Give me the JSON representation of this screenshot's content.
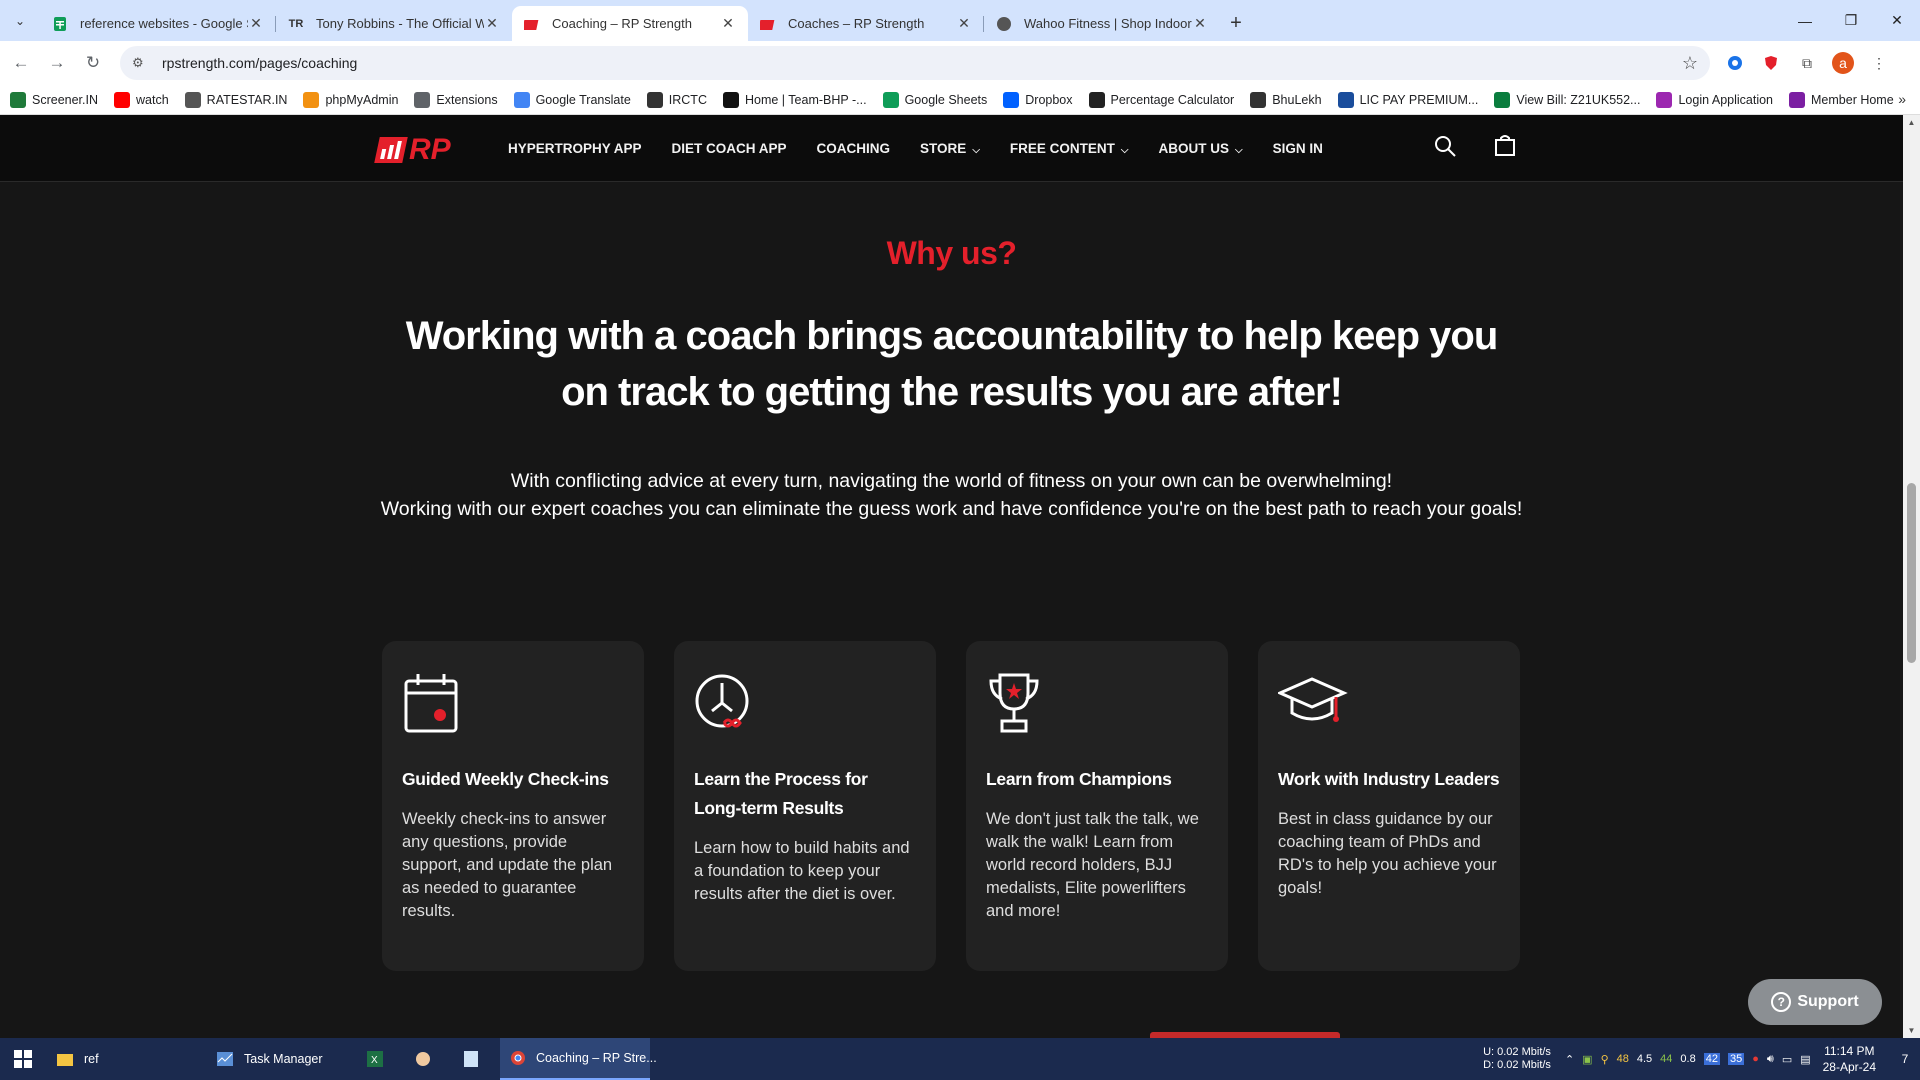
{
  "browser": {
    "tabs": [
      {
        "title": "reference websites - Google Sh",
        "icon": "sheets-icon",
        "active": false
      },
      {
        "title": "Tony Robbins - The Official Wel",
        "icon": "tr-icon",
        "icon_text": "TR",
        "active": false
      },
      {
        "title": "Coaching – RP Strength",
        "icon": "rp-icon",
        "active": true
      },
      {
        "title": "Coaches – RP Strength",
        "icon": "rp-icon",
        "active": false
      },
      {
        "title": "Wahoo Fitness | Shop Indoor Bi",
        "icon": "wahoo-icon",
        "active": false
      }
    ],
    "url": "rpstrength.com/pages/coaching",
    "bookmarks": [
      {
        "label": "Screener.IN",
        "icon_color": "#1f7a3a"
      },
      {
        "label": "watch",
        "icon_color": "#ff0000"
      },
      {
        "label": "RATESTAR.IN",
        "icon_color": "#555555"
      },
      {
        "label": "phpMyAdmin",
        "icon_color": "#f29111"
      },
      {
        "label": "Extensions",
        "icon_color": "#5f6368"
      },
      {
        "label": "Google Translate",
        "icon_color": "#4285f4"
      },
      {
        "label": "IRCTC",
        "icon_color": "#333333"
      },
      {
        "label": "Home | Team-BHP -...",
        "icon_color": "#111111"
      },
      {
        "label": "Google Sheets",
        "icon_color": "#0f9d58"
      },
      {
        "label": "Dropbox",
        "icon_color": "#0061ff"
      },
      {
        "label": "Percentage Calculator",
        "icon_color": "#222222"
      },
      {
        "label": "BhuLekh",
        "icon_color": "#333333"
      },
      {
        "label": "LIC PAY PREMIUM...",
        "icon_color": "#1a4d9c"
      },
      {
        "label": "View Bill: Z21UK552...",
        "icon_color": "#0a7d3e"
      },
      {
        "label": "Login Application",
        "icon_color": "#9c27b0"
      },
      {
        "label": "Member Home",
        "icon_color": "#7b1fa2"
      }
    ],
    "profile_initial": "a"
  },
  "site": {
    "logo_text": "RP",
    "nav": [
      {
        "label": "HYPERTROPHY APP",
        "dropdown": false
      },
      {
        "label": "DIET COACH APP",
        "dropdown": false
      },
      {
        "label": "COACHING",
        "dropdown": false
      },
      {
        "label": "STORE",
        "dropdown": true
      },
      {
        "label": "FREE CONTENT",
        "dropdown": true
      },
      {
        "label": "ABOUT US",
        "dropdown": true
      },
      {
        "label": "SIGN IN",
        "dropdown": false
      }
    ],
    "why_heading": "Why us?",
    "headline": "Working with a coach brings accountability to help keep you on track to getting the results you are after!",
    "intro_line1": "With conflicting advice at every turn, navigating the world of fitness on your own can be overwhelming!",
    "intro_line2": "Working with our expert coaches you can eliminate the guess work and have confidence you're on the best path to reach your goals!",
    "cards": [
      {
        "icon": "calendar-icon",
        "title": "Guided Weekly Check-ins",
        "text": "Weekly check-ins to answer any questions, provide support, and update the plan as needed to guarantee results."
      },
      {
        "icon": "clock-infinity-icon",
        "title": "Learn the Process for Long-term Results",
        "text": "Learn how to build habits and a foundation to keep your results after the diet is over."
      },
      {
        "icon": "trophy-icon",
        "title": "Learn from Champions",
        "text": "We don't just talk the talk, we walk the walk! Learn from world record holders, BJJ medalists, Elite powerlifters and more!"
      },
      {
        "icon": "graduation-cap-icon",
        "title": "Work with Industry Leaders",
        "text": "Best in class guidance by our coaching team of PhDs and RD's to help you achieve your goals!"
      }
    ],
    "support_label": "Support",
    "accent_color": "#e4202b"
  },
  "taskbar": {
    "items": [
      {
        "label": "ref",
        "icon": "folder-icon"
      },
      {
        "label": "Task Manager",
        "icon": "task-manager-icon"
      },
      {
        "label": "",
        "icon": "excel-icon"
      },
      {
        "label": "",
        "icon": "app-icon"
      },
      {
        "label": "",
        "icon": "notepad-icon"
      },
      {
        "label": "Coaching – RP Stre...",
        "icon": "chrome-icon",
        "active": true
      }
    ],
    "net_up_label": "U:",
    "net_down_label": "D:",
    "net_up": "0.02 Mbit/s",
    "net_down": "0.02 Mbit/s",
    "tray_values": [
      "48",
      "4.5",
      "44",
      "0.8"
    ],
    "tray_badges": [
      "42",
      "35"
    ],
    "time": "11:14 PM",
    "date": "28-Apr-24",
    "notification_count": "7"
  }
}
